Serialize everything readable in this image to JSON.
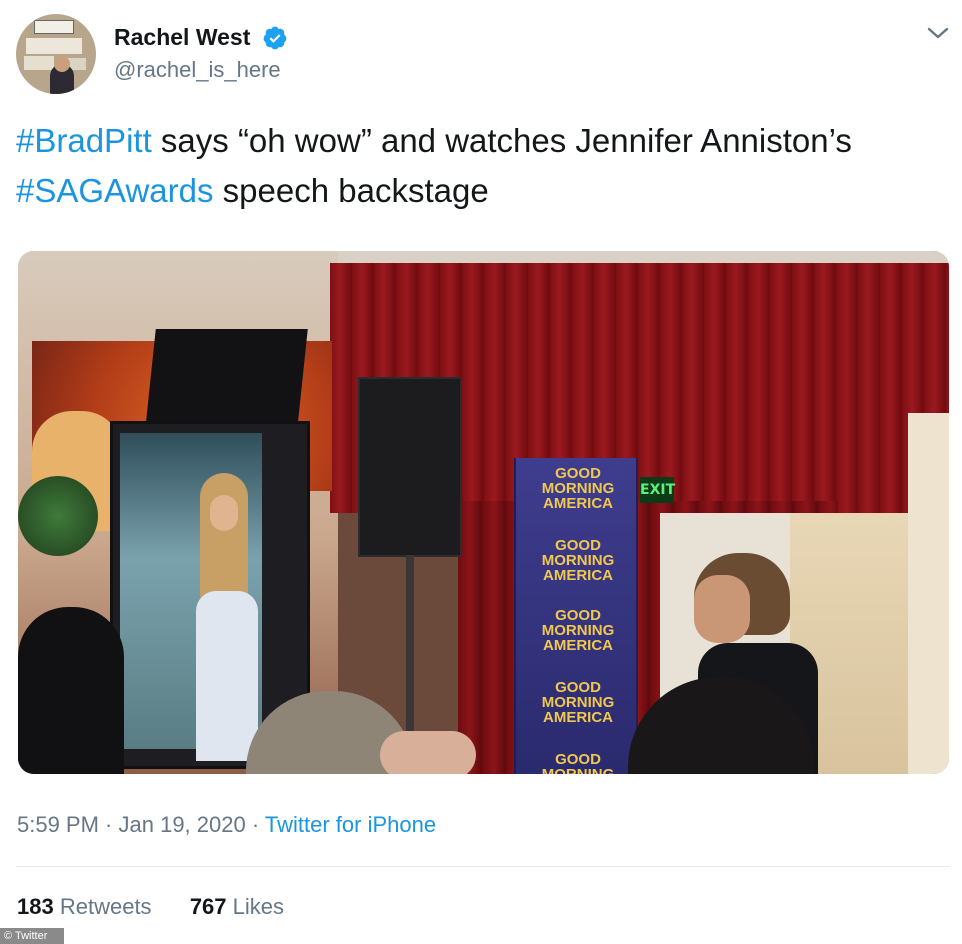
{
  "author": {
    "name": "Rachel West",
    "handle": "@rachel_is_here",
    "verified_icon": "verified-badge-icon",
    "avatar_icon": "profile-avatar"
  },
  "menu_icon": "chevron-down-icon",
  "tweet": {
    "segments": [
      {
        "text": "#BradPitt",
        "type": "hashtag"
      },
      {
        "text": " says “oh wow” and watches Jennifer Anniston’s ",
        "type": "text"
      },
      {
        "text": "#SAGAwards",
        "type": "hashtag"
      },
      {
        "text": " speech backstage",
        "type": "text"
      }
    ]
  },
  "media": {
    "exit_sign": "EXIT",
    "banner_lines": [
      "GOOD",
      "MORNING",
      "AMERICA"
    ]
  },
  "meta": {
    "time": "5:59 PM",
    "sep1": " · ",
    "date": "Jan 19, 2020",
    "sep2": " · ",
    "source": "Twitter for iPhone"
  },
  "stats": {
    "retweets_count": "183",
    "retweets_label": "Retweets",
    "likes_count": "767",
    "likes_label": "Likes"
  },
  "credit": "© Twitter",
  "colors": {
    "link": "#1b95e0",
    "secondary_text": "#657786",
    "primary_text": "#14171a"
  }
}
